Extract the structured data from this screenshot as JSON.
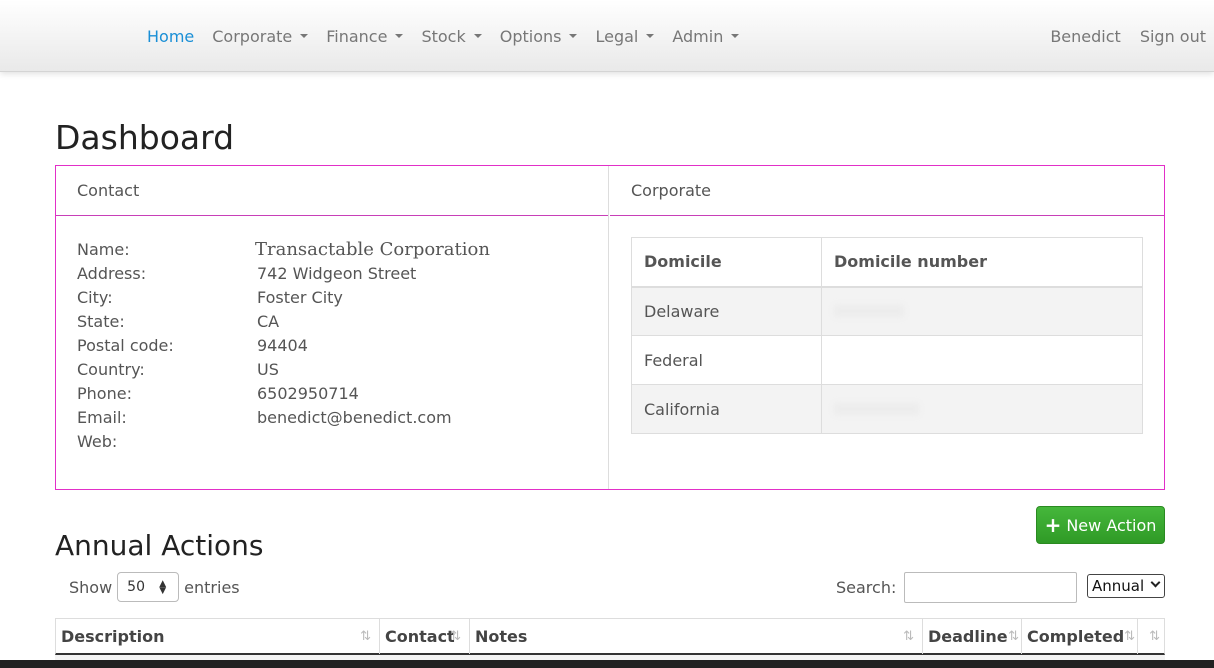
{
  "nav": {
    "items": [
      {
        "label": "Home",
        "active": true,
        "dropdown": false
      },
      {
        "label": "Corporate",
        "active": false,
        "dropdown": true
      },
      {
        "label": "Finance",
        "active": false,
        "dropdown": true
      },
      {
        "label": "Stock",
        "active": false,
        "dropdown": true
      },
      {
        "label": "Options",
        "active": false,
        "dropdown": true
      },
      {
        "label": "Legal",
        "active": false,
        "dropdown": true
      },
      {
        "label": "Admin",
        "active": false,
        "dropdown": true
      }
    ],
    "user": "Benedict",
    "sign_out": "Sign out"
  },
  "page_title": "Dashboard",
  "contact": {
    "heading": "Contact",
    "rows": [
      {
        "label": "Name:",
        "value": "Transactable Corporation"
      },
      {
        "label": "Address:",
        "value": "742 Widgeon Street"
      },
      {
        "label": "City:",
        "value": "Foster City"
      },
      {
        "label": "State:",
        "value": "CA"
      },
      {
        "label": "Postal code:",
        "value": "94404"
      },
      {
        "label": "Country:",
        "value": "US"
      },
      {
        "label": "Phone:",
        "value": "6502950714"
      },
      {
        "label": "Email:",
        "value": "benedict@benedict.com"
      },
      {
        "label": "Web:",
        "value": ""
      }
    ]
  },
  "corporate": {
    "heading": "Corporate",
    "columns": [
      "Domicile",
      "Domicile number"
    ],
    "rows": [
      {
        "domicile": "Delaware",
        "number_redacted": true
      },
      {
        "domicile": "Federal",
        "number_redacted": false
      },
      {
        "domicile": "California",
        "number_redacted": true
      }
    ]
  },
  "actions": {
    "title": "Annual Actions",
    "new_button": "New Action",
    "show_label": "Show",
    "entries_value": "50",
    "entries_label": "entries",
    "search_label": "Search:",
    "search_value": "",
    "period_value": "Annual",
    "columns": [
      "Description",
      "Contact",
      "Notes",
      "Deadline",
      "Completed",
      ""
    ]
  },
  "colors": {
    "nav_active": "#1a8fd6",
    "panel_border": "#e22fc8",
    "button_green": "#3aab31"
  }
}
